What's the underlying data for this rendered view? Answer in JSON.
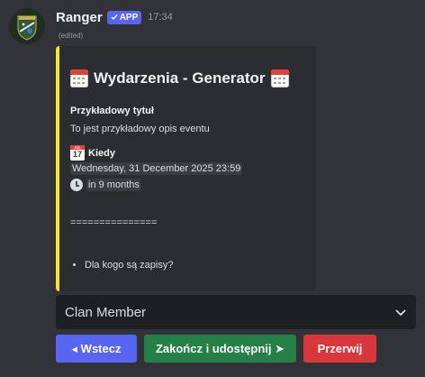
{
  "message": {
    "username": "Ranger",
    "app_badge": "APP",
    "timestamp": "17:34",
    "edited": "(edited)"
  },
  "embed": {
    "accent_color": "#f1e62d",
    "title": "Wydarzenia - Generator",
    "title_icon": "calendar-icon",
    "field_name": "Przykładowy tytuł",
    "field_value": "To jest przykładowy opis eventu",
    "when_label": "Kiedy",
    "when_icon_day": "17",
    "when_icon_month": "JUL",
    "date_text": "Wednesday, 31 December 2025 23:59",
    "relative_text": "in 9 months",
    "divider": "===============",
    "bullets": [
      "Dla kogo są zapisy?"
    ]
  },
  "select": {
    "value": "Clan Member"
  },
  "buttons": {
    "back": "◂ Wstecz",
    "finish": "Zakończ i udostępnij ➤",
    "abort": "Przerwij"
  },
  "colors": {
    "background": "#323339",
    "blurple": "#5865f2",
    "green": "#248046",
    "red": "#da373c"
  }
}
